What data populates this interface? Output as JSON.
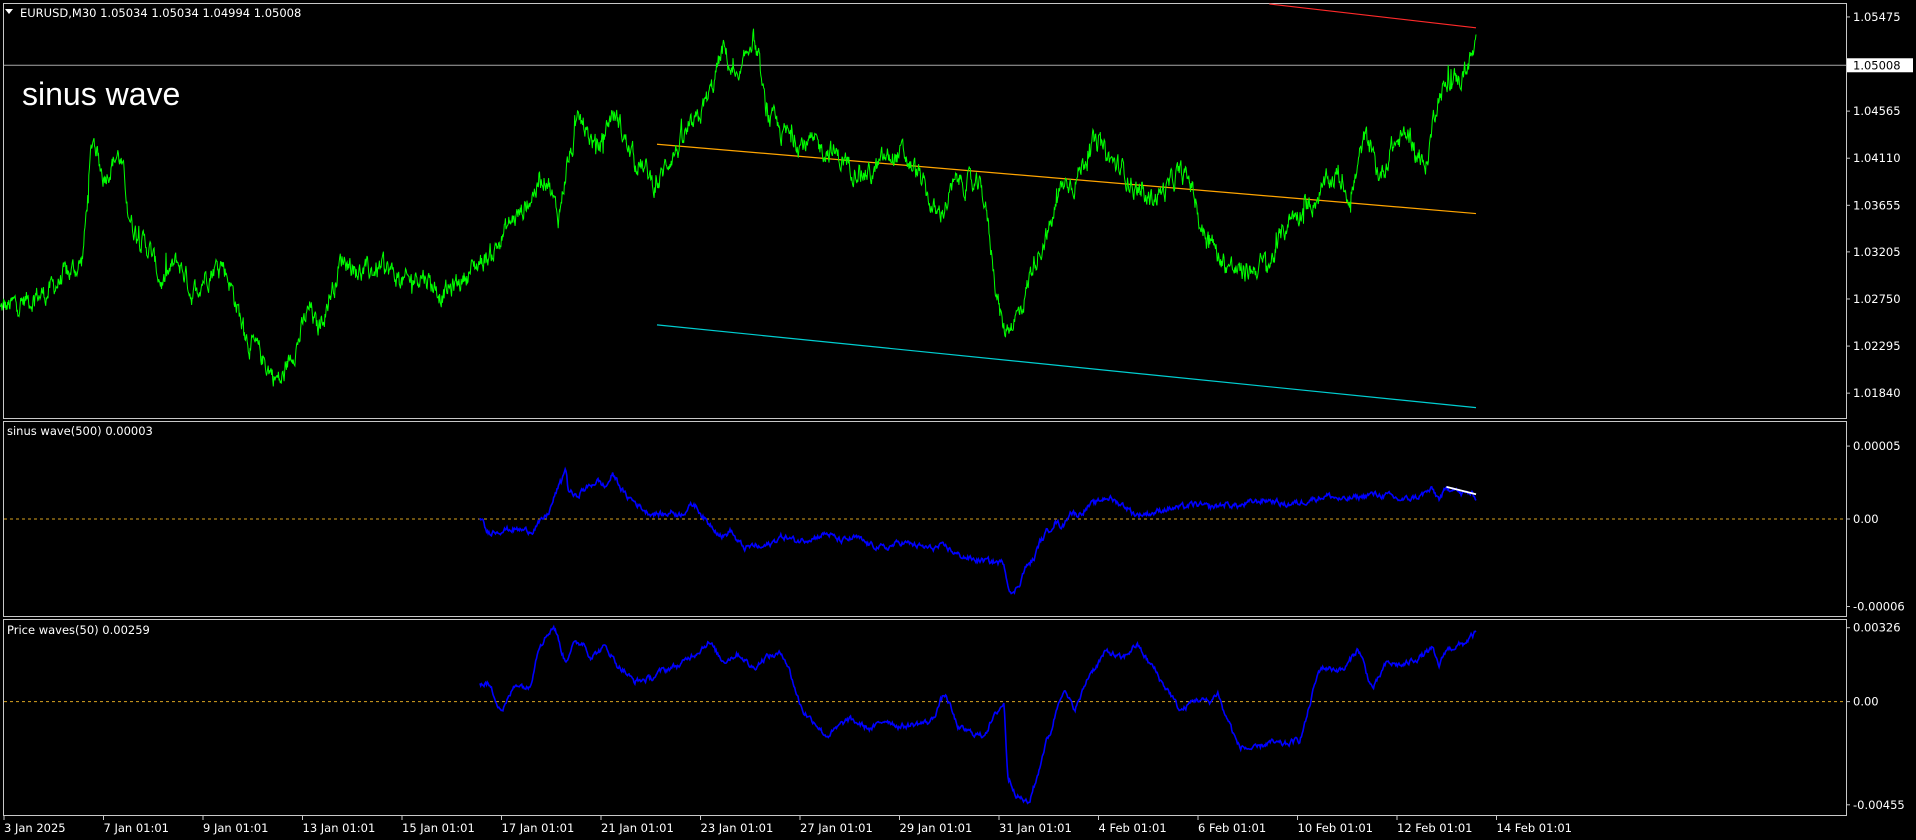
{
  "header": {
    "symbol_line": "EURUSD,M30  1.05034 1.05034 1.04994 1.05008",
    "menu_arrow": "triangle-down-icon"
  },
  "overlay_title": "sinus wave",
  "colors": {
    "background": "#000000",
    "price": "#00ff00",
    "indicator": "#0000ff",
    "zero_line": "#daa520",
    "channel_upper": "#ff2a2a",
    "channel_mid": "#ffa500",
    "channel_lower": "#00ced1",
    "trend_white": "#ffffff",
    "frame": "#c8c8c8"
  },
  "x_axis": {
    "labels": [
      "3 Jan 2025",
      "7 Jan 01:01",
      "9 Jan 01:01",
      "13 Jan 01:01",
      "15 Jan 01:01",
      "17 Jan 01:01",
      "21 Jan 01:01",
      "23 Jan 01:01",
      "27 Jan 01:01",
      "29 Jan 01:01",
      "31 Jan 01:01",
      "4 Feb 01:01",
      "6 Feb 01:01",
      "10 Feb 01:01",
      "12 Feb 01:01",
      "14 Feb 01:01"
    ]
  },
  "chart_data": [
    {
      "type": "line",
      "name": "main",
      "title": "EURUSD,M30",
      "ylim": [
        1.016,
        1.056
      ],
      "y_ticks": [
        "1.05475",
        "1.05008",
        "1.04565",
        "1.04110",
        "1.03655",
        "1.03205",
        "1.02750",
        "1.02295",
        "1.01840"
      ],
      "y_tick_values": [
        1.05475,
        1.05008,
        1.04565,
        1.0411,
        1.03655,
        1.03205,
        1.0275,
        1.02295,
        1.0184
      ],
      "current_price": 1.05008,
      "current_price_label": "1.05008",
      "x_index_range": [
        0,
        1000
      ],
      "price_keypoints_x": [
        0,
        30,
        45,
        55,
        63,
        70,
        80,
        90,
        100,
        110,
        120,
        125,
        130,
        140,
        150,
        170,
        190,
        200,
        210,
        215,
        220,
        225,
        232,
        245,
        260,
        275,
        285,
        300,
        330,
        350,
        370,
        378,
        385,
        393,
        405,
        415,
        430,
        445,
        455,
        470,
        480,
        490,
        500,
        510,
        520,
        530,
        545,
        560,
        575,
        590,
        600,
        610,
        620,
        635,
        650,
        665,
        680,
        690,
        703,
        710,
        720,
        728,
        740,
        760,
        775,
        790,
        798,
        806,
        815,
        830,
        840,
        860,
        875,
        890,
        905,
        915,
        925,
        935,
        945,
        955,
        965,
        975,
        990,
        1000
      ],
      "price_keypoints_y": [
        1.0265,
        1.028,
        1.0298,
        1.031,
        1.043,
        1.0395,
        1.0415,
        1.0345,
        1.0325,
        1.029,
        1.031,
        1.03,
        1.028,
        1.03,
        1.031,
        1.023,
        1.0195,
        1.023,
        1.0265,
        1.0245,
        1.0265,
        1.0285,
        1.0315,
        1.03,
        1.0305,
        1.029,
        1.03,
        1.028,
        1.0315,
        1.0355,
        1.0395,
        1.0355,
        1.041,
        1.0445,
        1.042,
        1.0455,
        1.041,
        1.0385,
        1.0415,
        1.044,
        1.047,
        1.0515,
        1.048,
        1.053,
        1.045,
        1.0435,
        1.0425,
        1.042,
        1.0405,
        1.0395,
        1.041,
        1.0415,
        1.04,
        1.0355,
        1.039,
        1.038,
        1.0245,
        1.026,
        1.032,
        1.034,
        1.0385,
        1.039,
        1.0425,
        1.04,
        1.037,
        1.038,
        1.0395,
        1.039,
        1.034,
        1.031,
        1.03,
        1.031,
        1.0355,
        1.037,
        1.0395,
        1.0375,
        1.043,
        1.0395,
        1.0425,
        1.0435,
        1.04,
        1.0475,
        1.049,
        1.0515
      ],
      "channel_lines": [
        {
          "role": "upper",
          "points": [
            [
              860,
              1.056
            ],
            [
              1000,
              1.0537
            ]
          ]
        },
        {
          "role": "mid",
          "points": [
            [
              445,
              1.04245
            ],
            [
              1000,
              1.03575
            ]
          ]
        },
        {
          "role": "lower",
          "points": [
            [
              445,
              1.025
            ],
            [
              1000,
              1.017
            ]
          ]
        }
      ]
    },
    {
      "type": "line",
      "name": "sub1",
      "title": "sinus wave(500) 0.00003",
      "ylim": [
        -6.65e-05,
        6.65e-05
      ],
      "y_ticks": [
        "0.00005",
        "0.00",
        "-0.00006"
      ],
      "y_tick_values": [
        5e-05,
        0.0,
        -6e-05
      ],
      "zero_line": 0,
      "x_index_range": [
        0,
        1000
      ],
      "series_keypoints_x": [
        325,
        330,
        345,
        360,
        365,
        370,
        380,
        383,
        385,
        390,
        395,
        405,
        410,
        415,
        425,
        440,
        450,
        455,
        460,
        470,
        480,
        490,
        495,
        500,
        505,
        512,
        515,
        520,
        530,
        540,
        550,
        560,
        570,
        580,
        590,
        600,
        610,
        630,
        640,
        650,
        660,
        680,
        683,
        686,
        690,
        695,
        700,
        705,
        710,
        715,
        720,
        725,
        730,
        740,
        750,
        760,
        770,
        780,
        790,
        800,
        810,
        820,
        830,
        840,
        850,
        860,
        870,
        880,
        890,
        900,
        910,
        920,
        930,
        940,
        950,
        960,
        970,
        975,
        980,
        985,
        990,
        995,
        1000
      ],
      "series_keypoints_y": [
        2e-06,
        -9e-06,
        -7e-06,
        -8e-06,
        -3e-06,
        2e-06,
        2.5e-05,
        3.5e-05,
        2e-05,
        1.5e-05,
        2e-05,
        2.6e-05,
        2.2e-05,
        3e-05,
        1.5e-05,
        4e-06,
        3e-06,
        5e-06,
        3e-06,
        1e-05,
        -3e-06,
        -1.2e-05,
        -8e-06,
        -1.6e-05,
        -2e-05,
        -1.8e-05,
        -2e-05,
        -1.8e-05,
        -1.2e-05,
        -1.5e-05,
        -1.3e-05,
        -1e-05,
        -1.5e-05,
        -1.3e-05,
        -1.8e-05,
        -2e-05,
        -1.6e-05,
        -2e-05,
        -1.9e-05,
        -2.5e-05,
        -2.8e-05,
        -3e-05,
        -4.5e-05,
        -5.2e-05,
        -4.5e-05,
        -3.3e-05,
        -2.8e-05,
        -1.5e-05,
        -8e-06,
        -2e-06,
        -5e-06,
        5e-06,
        3e-06,
        1e-05,
        1.5e-05,
        1e-05,
        3e-06,
        4e-06,
        7e-06,
        8e-06,
        1e-05,
        8e-06,
        1e-05,
        9e-06,
        1.2e-05,
        1.3e-05,
        1e-05,
        1.1e-05,
        1.4e-05,
        1.6e-05,
        1.3e-05,
        1.5e-05,
        1.7e-05,
        1.6e-05,
        1.3e-05,
        1.5e-05,
        2e-05,
        1.4e-05,
        2e-05,
        2.2e-05,
        1.7e-05,
        1.8e-05,
        1.5e-05
      ],
      "trend_line": [
        [
          980,
          2.2e-05
        ],
        [
          1000,
          1.7e-05
        ]
      ]
    },
    {
      "type": "line",
      "name": "sub2",
      "title": "Price waves(50) 0.00259",
      "ylim": [
        -0.005,
        0.0036
      ],
      "y_ticks": [
        "0.00326",
        "0.00",
        "-0.00455"
      ],
      "y_tick_values": [
        0.00326,
        0.0,
        -0.00455
      ],
      "zero_line": 0,
      "x_index_range": [
        0,
        1000
      ],
      "series_keypoints_x": [
        325,
        330,
        340,
        350,
        358,
        366,
        375,
        383,
        388,
        395,
        400,
        410,
        420,
        430,
        440,
        450,
        460,
        470,
        480,
        490,
        500,
        510,
        520,
        530,
        545,
        550,
        560,
        575,
        590,
        600,
        610,
        630,
        640,
        650,
        665,
        680,
        683,
        690,
        697,
        700,
        710,
        720,
        728,
        740,
        750,
        760,
        770,
        780,
        790,
        800,
        810,
        820,
        825,
        830,
        840,
        850,
        860,
        870,
        880,
        895,
        910,
        920,
        930,
        940,
        950,
        960,
        970,
        975,
        980,
        990,
        1000
      ],
      "series_keypoints_y": [
        0.00075,
        0.0008,
        -0.00035,
        0.0008,
        0.0006,
        0.0026,
        0.0033,
        0.0018,
        0.0025,
        0.0026,
        0.002,
        0.0024,
        0.0015,
        0.0009,
        0.001,
        0.0014,
        0.0016,
        0.0021,
        0.0026,
        0.0018,
        0.0021,
        0.0015,
        0.002,
        0.0021,
        -0.0005,
        -0.0008,
        -0.0015,
        -0.0008,
        -0.0012,
        -0.0008,
        -0.0011,
        -0.0009,
        0.0003,
        -0.0012,
        -0.0015,
        -0.0001,
        -0.0034,
        -0.0042,
        -0.0045,
        -0.0038,
        -0.0016,
        0.0005,
        -0.0003,
        0.0014,
        0.0022,
        0.0019,
        0.0025,
        0.0016,
        0.0006,
        -0.0004,
        0.0001,
        0.0,
        0.0004,
        -0.0006,
        -0.002,
        -0.0021,
        -0.0018,
        -0.0019,
        -0.0017,
        0.0015,
        0.0014,
        0.0023,
        0.0006,
        0.0017,
        0.0016,
        0.0019,
        0.0023,
        0.0016,
        0.0023,
        0.0025,
        0.003
      ]
    }
  ]
}
